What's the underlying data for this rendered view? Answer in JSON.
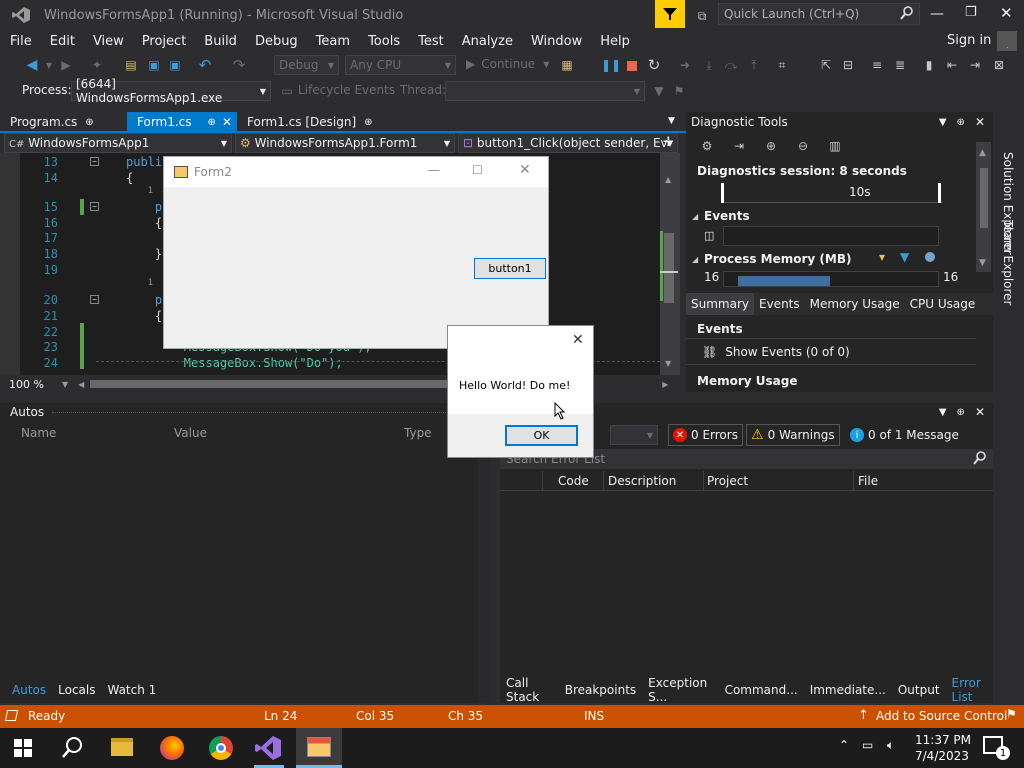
{
  "title_bar": {
    "title": "WindowsFormsApp1 (Running) - Microsoft Visual Studio",
    "quick_launch_placeholder": "Quick Launch (Ctrl+Q)"
  },
  "menu": [
    "File",
    "Edit",
    "View",
    "Project",
    "Build",
    "Debug",
    "Team",
    "Tools",
    "Test",
    "Analyze",
    "Window",
    "Help"
  ],
  "sign_in": "Sign in",
  "toolbar": {
    "config": "Debug",
    "platform": "Any CPU",
    "continue": "Continue"
  },
  "process_bar": {
    "label": "Process:",
    "process": "[6644] WindowsFormsApp1.exe",
    "lifecycle": "Lifecycle Events",
    "thread_label": "Thread:"
  },
  "editor_tabs": [
    "Program.cs",
    "Form1.cs",
    "Form1.cs [Design]"
  ],
  "nav": {
    "project": "WindowsFormsApp1",
    "class": "WindowsFormsApp1.Form1",
    "member": "button1_Click(object sender, EventA"
  },
  "code_lines": [
    {
      "n": "13",
      "t": "publi"
    },
    {
      "n": "14",
      "t": "{"
    },
    {
      "n": "",
      "t": "    1"
    },
    {
      "n": "15",
      "t": "    pu"
    },
    {
      "n": "16",
      "t": "    {"
    },
    {
      "n": "17",
      "t": ""
    },
    {
      "n": "18",
      "t": "    }"
    },
    {
      "n": "19",
      "t": ""
    },
    {
      "n": "",
      "t": "    1"
    },
    {
      "n": "20",
      "t": "    pr"
    },
    {
      "n": "21",
      "t": "    {"
    },
    {
      "n": "22",
      "t": ""
    },
    {
      "n": "23",
      "t": "        MessageBox.Show(\"Do you\");"
    },
    {
      "n": "24",
      "t": "        MessageBox.Show(\"Do\");"
    }
  ],
  "editor_zoom": "100 %",
  "form2": {
    "title": "Form2",
    "button": "button1"
  },
  "msgbox": {
    "text": "Hello World! Do me!",
    "ok": "OK"
  },
  "diag": {
    "title": "Diagnostic Tools",
    "session": "Diagnostics session: 8 seconds",
    "tick": "10s",
    "events": "Events",
    "memory": "Process Memory (MB)",
    "mem_left": "16",
    "mem_right": "16",
    "tabs": [
      "Summary",
      "Events",
      "Memory Usage",
      "CPU Usage"
    ],
    "events_hdr": "Events",
    "show_events": "Show Events (0 of 0)",
    "memory_usage": "Memory Usage"
  },
  "side_tabs": [
    "Solution Explorer",
    "Team Explorer"
  ],
  "autos": {
    "title": "Autos",
    "cols": [
      "Name",
      "Value",
      "Type"
    ]
  },
  "errors": {
    "errors": "0 Errors",
    "warnings": "0 Warnings",
    "messages": "0 of 1 Message",
    "search": "Search Error List",
    "cols": [
      "Code",
      "Description",
      "Project",
      "File"
    ]
  },
  "bottom_left_tabs": [
    "Autos",
    "Locals",
    "Watch 1"
  ],
  "bottom_right_tabs": [
    "Call Stack",
    "Breakpoints",
    "Exception S...",
    "Command...",
    "Immediate...",
    "Output",
    "Error List"
  ],
  "status": {
    "ready": "Ready",
    "ln": "Ln 24",
    "col": "Col 35",
    "ch": "Ch 35",
    "ins": "INS",
    "source": "Add to Source Control"
  },
  "clock": {
    "time": "11:37 PM",
    "date": "7/4/2023"
  },
  "colors": {
    "accent": "#007acc",
    "status": "#ca5100"
  }
}
